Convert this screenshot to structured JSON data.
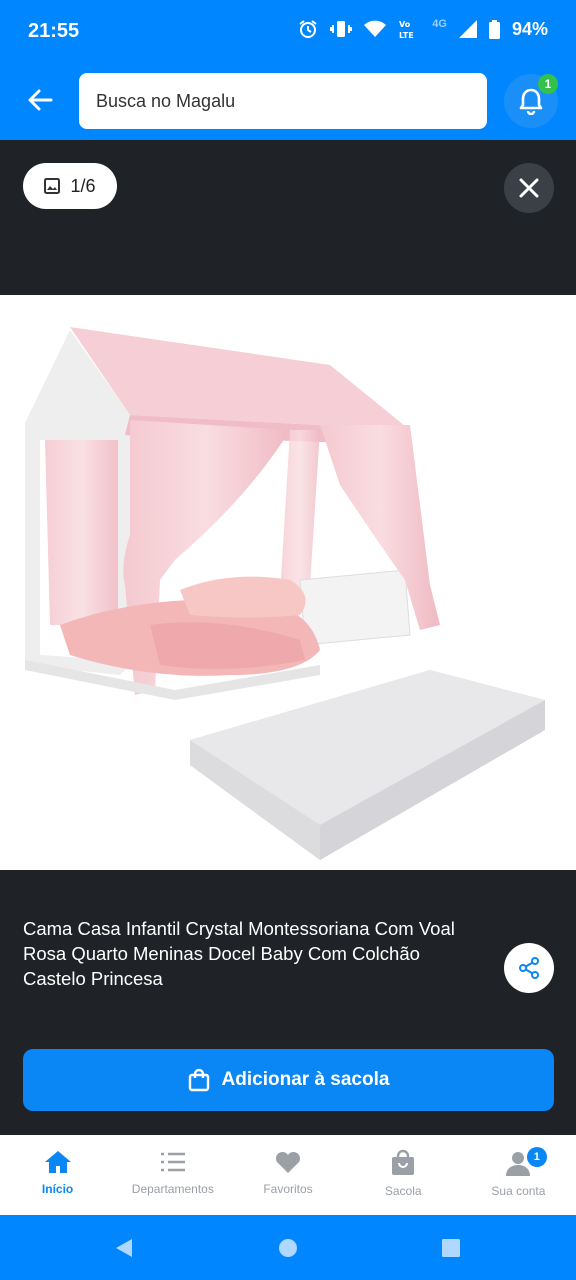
{
  "status_bar": {
    "time": "21:55",
    "battery": "94%",
    "network": "4G"
  },
  "search": {
    "placeholder": "Busca no Magalu",
    "notification_count": "1"
  },
  "gallery": {
    "counter": "1/6"
  },
  "product": {
    "title": "Cama Casa Infantil Crystal Montessoriana Com Voal Rosa Quarto Meninas Docel Baby Com Colchão Castelo Princesa",
    "add_to_bag_label": "Adicionar à sacola"
  },
  "bottom_nav": {
    "items": [
      {
        "label": "Início",
        "icon": "home-icon"
      },
      {
        "label": "Departamentos",
        "icon": "list-icon"
      },
      {
        "label": "Favoritos",
        "icon": "heart-icon"
      },
      {
        "label": "Sacola",
        "icon": "bag-icon"
      },
      {
        "label": "Sua conta",
        "icon": "user-icon"
      }
    ],
    "account_badge": "1"
  },
  "colors": {
    "brand_blue": "#0086ff",
    "dark_bg": "#1f2327",
    "badge_green": "#33c14b"
  }
}
